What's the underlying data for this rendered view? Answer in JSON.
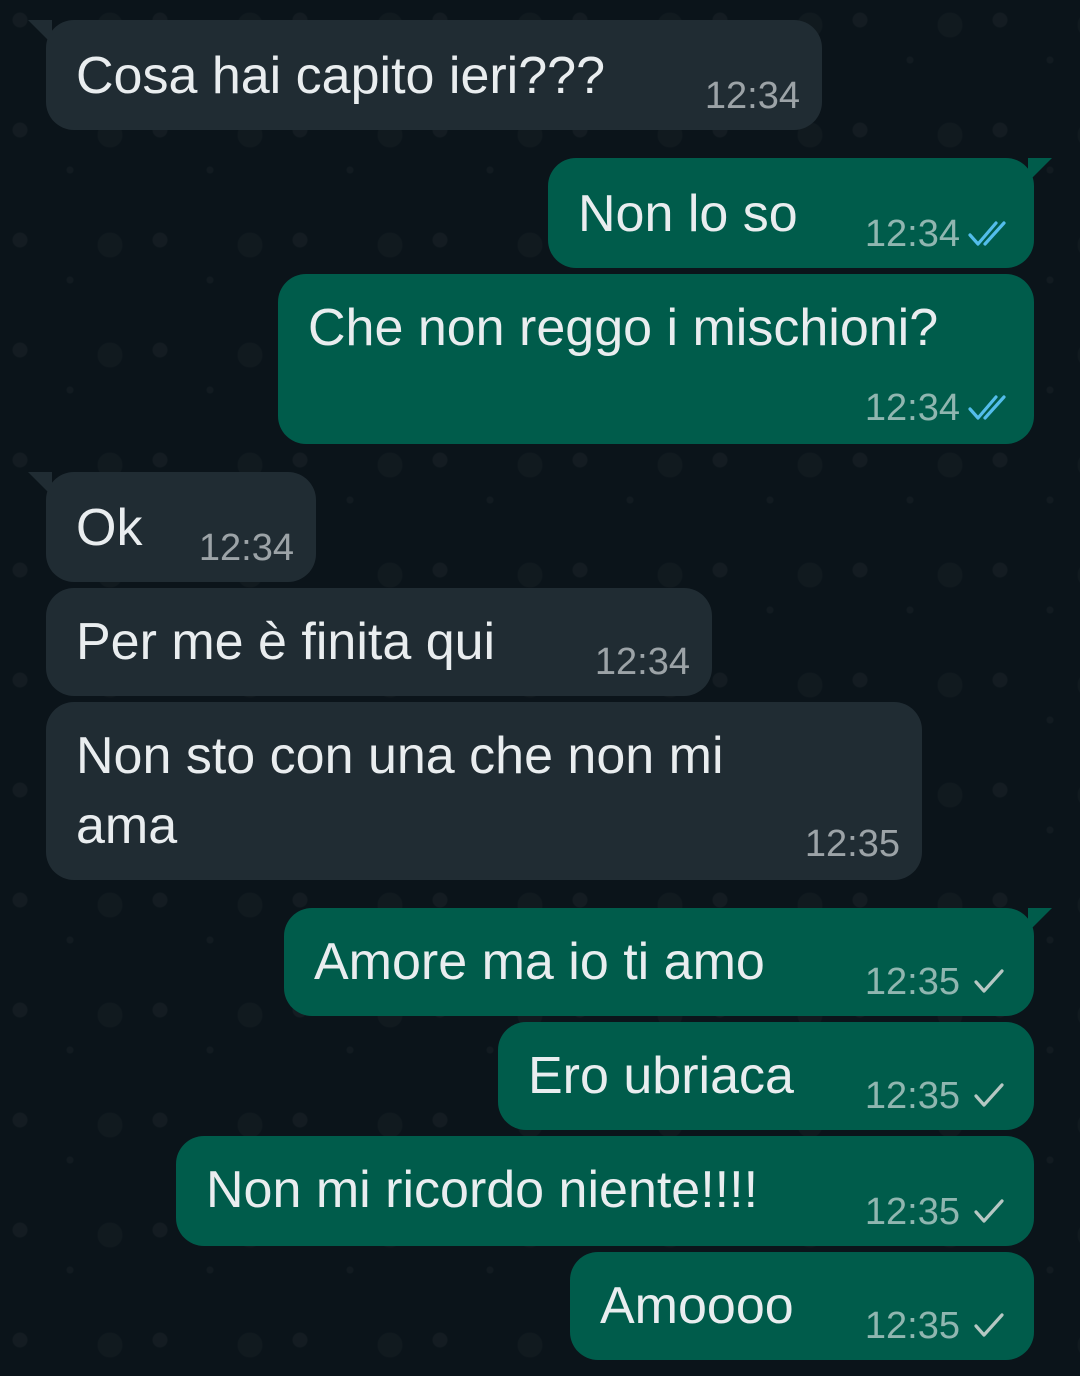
{
  "colors": {
    "background": "#0b141a",
    "incoming_bubble": "#202c33",
    "outgoing_bubble": "#005c4b",
    "text": "#e9edef",
    "read_check": "#53bdeb",
    "sent_check": "#b6c7c3"
  },
  "messages": [
    {
      "direction": "incoming",
      "text": "Cosa hai capito ieri???",
      "time": "12:34",
      "status": null
    },
    {
      "direction": "outgoing",
      "text": "Non lo so",
      "time": "12:34",
      "status": "read"
    },
    {
      "direction": "outgoing",
      "text": "Che non reggo i mischioni?",
      "time": "12:34",
      "status": "read"
    },
    {
      "direction": "incoming",
      "text": "Ok",
      "time": "12:34",
      "status": null
    },
    {
      "direction": "incoming",
      "text": "Per me è finita qui",
      "time": "12:34",
      "status": null
    },
    {
      "direction": "incoming",
      "text_lines": [
        "Non sto con una che non mi",
        "ama"
      ],
      "time": "12:35",
      "status": null
    },
    {
      "direction": "outgoing",
      "text": "Amore ma io ti amo",
      "time": "12:35",
      "status": "sent"
    },
    {
      "direction": "outgoing",
      "text": "Ero ubriaca",
      "time": "12:35",
      "status": "sent"
    },
    {
      "direction": "outgoing",
      "text": "Non mi ricordo niente!!!!",
      "time": "12:35",
      "status": "sent"
    },
    {
      "direction": "outgoing",
      "text": "Amoooo",
      "time": "12:35",
      "status": "sent"
    }
  ]
}
